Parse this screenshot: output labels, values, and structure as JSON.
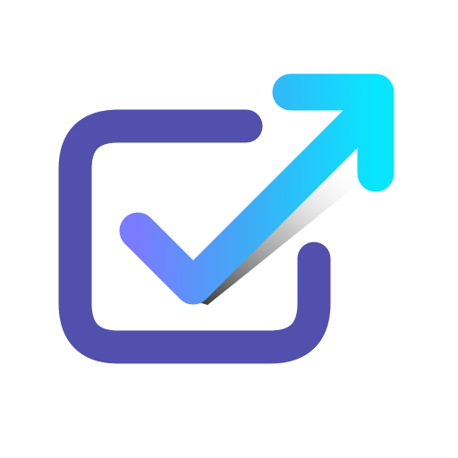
{
  "icon": {
    "name": "checkbox-arrow-icon",
    "colors": {
      "box": "#5150AD",
      "arrow_start": "#7A7CFF",
      "arrow_mid": "#3FAAF6",
      "arrow_end": "#08E6FF",
      "shadow": "#202020"
    }
  }
}
